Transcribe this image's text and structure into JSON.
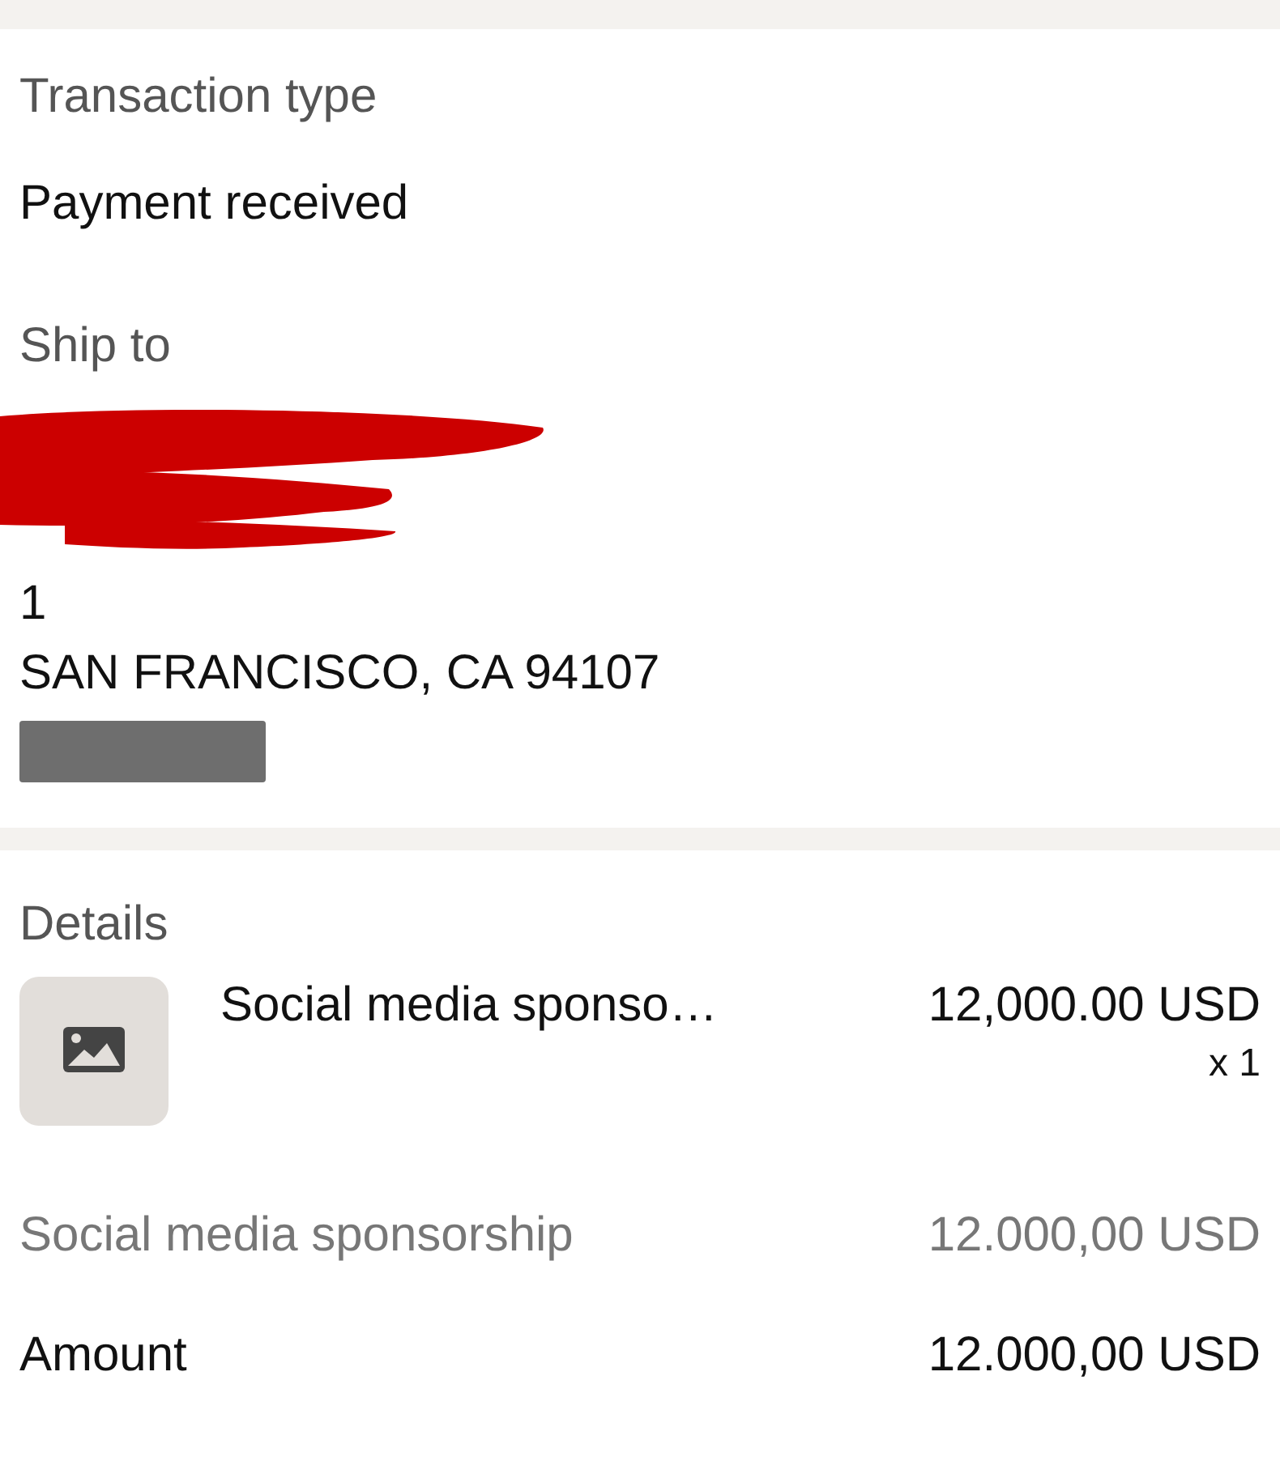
{
  "transaction": {
    "label": "Transaction type",
    "value": "Payment received"
  },
  "ship_to": {
    "label": "Ship to",
    "address_lines": [
      "1",
      "SAN FRANCISCO, CA 94107"
    ]
  },
  "details": {
    "title": "Details",
    "items": [
      {
        "kind": "picture",
        "name": "Social media sponso…",
        "price": "12,000.00 USD",
        "quantity": "x 1"
      }
    ],
    "summary": [
      {
        "kind": "line",
        "label": "Social media sponsorship",
        "value": "12.000,00 USD"
      },
      {
        "kind": "total",
        "label": "Amount",
        "value": "12.000,00 USD"
      }
    ]
  }
}
